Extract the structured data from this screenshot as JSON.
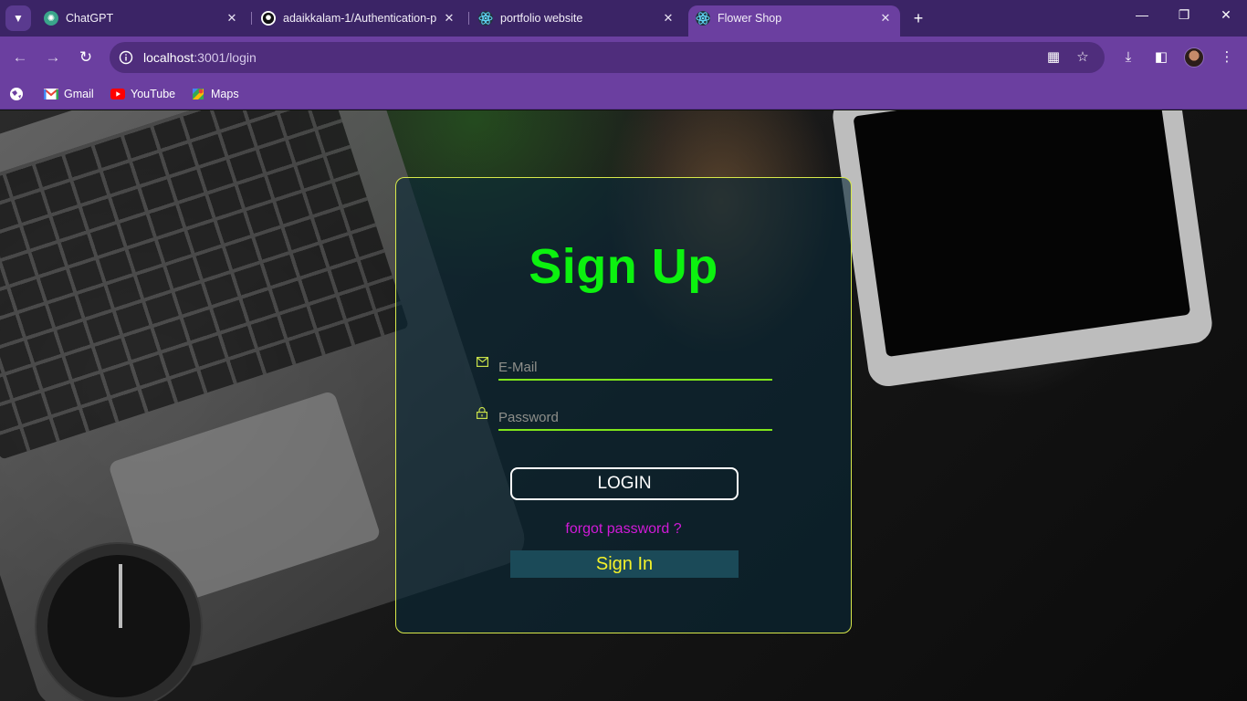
{
  "browser": {
    "tabs": [
      {
        "title": "ChatGPT",
        "active": false
      },
      {
        "title": "adaikkalam-1/Authentication-p",
        "active": false
      },
      {
        "title": "portfolio website",
        "active": false
      },
      {
        "title": "Flower Shop",
        "active": true
      }
    ],
    "new_tab": "+",
    "close_glyph": "✕",
    "window_controls": {
      "minimize": "—",
      "maximize": "❐",
      "close": "✕"
    },
    "url_host": "localhost",
    "url_path": ":3001/login",
    "bookmarks": [
      {
        "label": "Gmail"
      },
      {
        "label": "YouTube"
      },
      {
        "label": "Maps"
      }
    ],
    "colors": {
      "frame": "#3b2466",
      "toolbar": "#6b3fa0",
      "omnibox": "#4f2d7c"
    }
  },
  "page": {
    "heading": "Sign Up",
    "email_placeholder": "E-Mail",
    "password_placeholder": "Password",
    "login_label": "LOGIN",
    "forgot_label": "forgot password ?",
    "signin_label": "Sign In",
    "colors": {
      "heading": "#0cf20f",
      "underline": "#7fe61a",
      "forgot": "#d11ad8",
      "signin_text": "#f4f22a",
      "card_border": "#d8e84a"
    }
  }
}
